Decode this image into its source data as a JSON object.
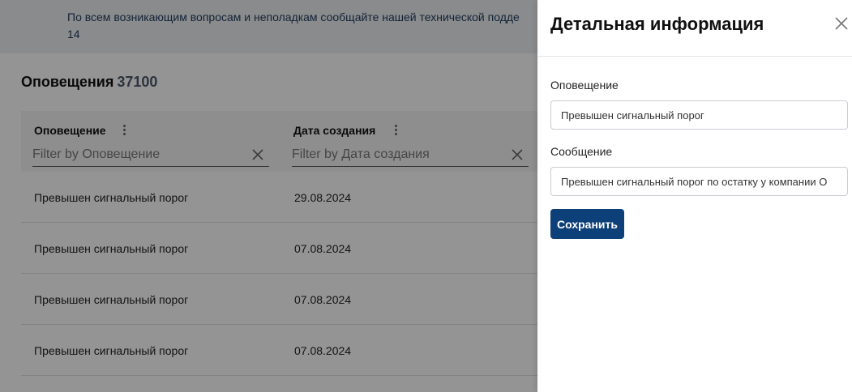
{
  "banner": {
    "line1": "По всем возникающим вопросам и неполадкам сообщайте нашей технической подде",
    "line2": "14"
  },
  "page": {
    "title": "Оповещения",
    "count": "37100"
  },
  "table": {
    "columns": [
      {
        "label": "Оповещение",
        "filter_placeholder": "Filter by Оповещение"
      },
      {
        "label": "Дата создания",
        "filter_placeholder": "Filter by Дата создания"
      }
    ],
    "rows": [
      {
        "notification": "Превышен сигнальный порог",
        "date": "29.08.2024"
      },
      {
        "notification": "Превышен сигнальный порог",
        "date": "07.08.2024"
      },
      {
        "notification": "Превышен сигнальный порог",
        "date": "07.08.2024"
      },
      {
        "notification": "Превышен сигнальный порог",
        "date": "07.08.2024"
      }
    ]
  },
  "panel": {
    "title": "Детальная информация",
    "notification_label": "Оповещение",
    "notification_value": "Превышен сигнальный порог",
    "message_label": "Сообщение",
    "message_value": "Превышен сигнальный порог по остатку у компании О",
    "save_label": "Сохранить"
  },
  "colors": {
    "primary_button": "#0d3f78",
    "overlay": "rgba(0,0,0,0.42)",
    "banner_bg": "#eef0f3"
  },
  "icons": {
    "close": "close-icon",
    "column_menu": "vertical-dots-icon",
    "filter_clear": "x-icon"
  }
}
